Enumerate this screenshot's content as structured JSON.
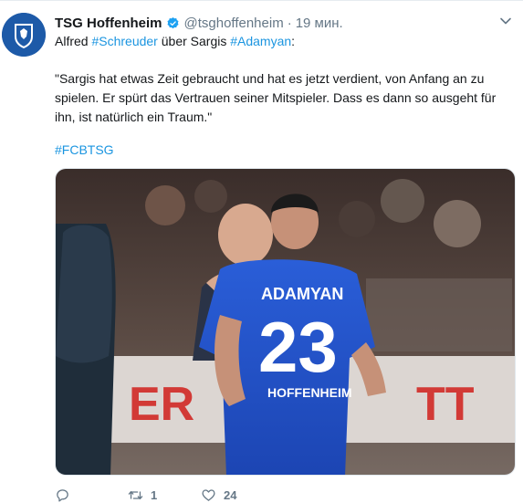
{
  "tweet": {
    "author_name": "TSG Hoffenheim",
    "author_handle": "@tsghoffenheim",
    "separator": "·",
    "time": "19 мин.",
    "line1": {
      "pre": "Alfred ",
      "tag1": "#Schreuder",
      "mid": " über Sargis ",
      "tag2": "#Adamyan",
      "post": ":"
    },
    "quote": "\"Sargis hat etwas Zeit gebraucht und hat es jetzt verdient, von Anfang an zu spielen. Er spürt das Vertrauen seiner Mitspieler. Dass es dann so ausgeht für ihn, ist natürlich ein Traum.\"",
    "hashtag": "#FCBTSG",
    "photo": {
      "jersey_name": "ADAMYAN",
      "jersey_number": "23",
      "sponsor_text": "HOFFENHEIM",
      "banner_letters": "ER",
      "banner_letters_right": "TT"
    },
    "actions": {
      "reply_count": "",
      "retweet_count": "1",
      "like_count": "24"
    }
  },
  "colors": {
    "link": "#1b95e0",
    "muted": "#657786",
    "verified": "#1da1f2",
    "brand_blue": "#1d5aa8"
  },
  "icons": {
    "reply": "reply-icon",
    "retweet": "retweet-icon",
    "like": "heart-icon",
    "verified": "verified-badge-icon",
    "menu": "chevron-down-icon"
  }
}
